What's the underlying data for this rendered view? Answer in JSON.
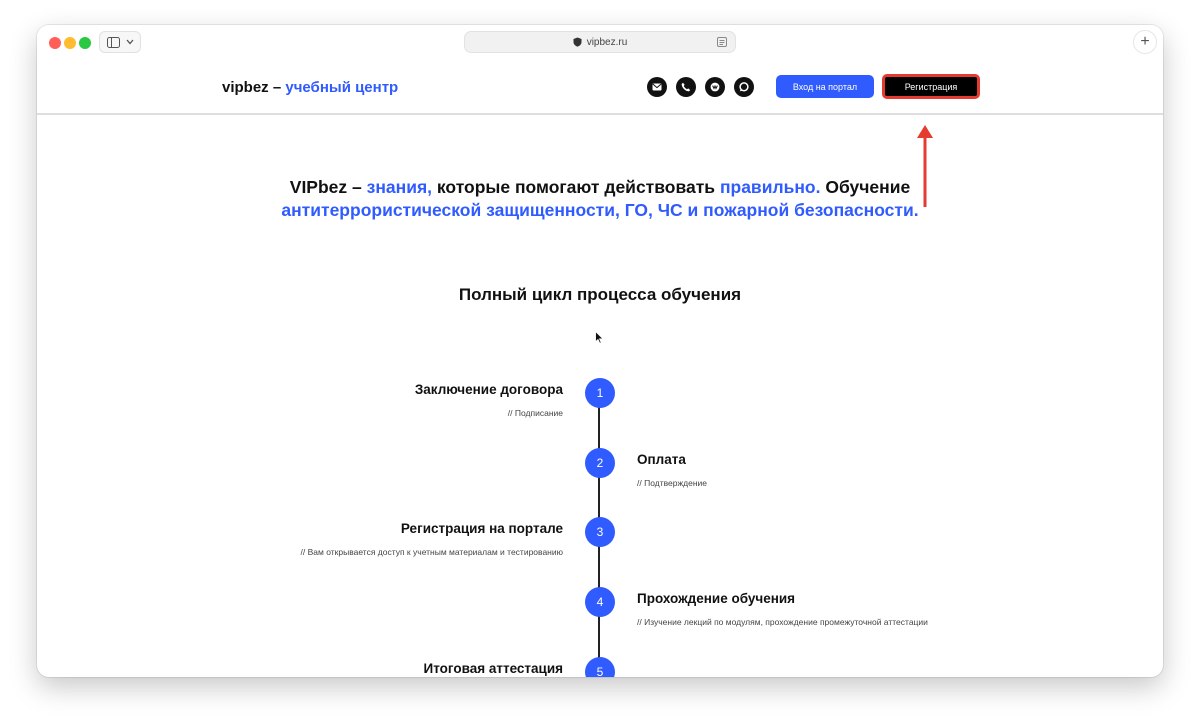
{
  "browser": {
    "url": "vipbez.ru",
    "traffic_lights": [
      "#ff5f57",
      "#febc2e",
      "#28c840"
    ]
  },
  "header": {
    "logo_main": "vipbez –",
    "logo_accent": "учебный центр",
    "social_icons": [
      "mail-icon",
      "phone-icon",
      "vk-icon",
      "chat-icon"
    ],
    "portal_button": "Вход на портал",
    "register_button": "Регистрация"
  },
  "hero": {
    "part1": "VIPbez –",
    "part2": "знания,",
    "part3": "которые помогают действовать",
    "part4": "правильно.",
    "part5": "Обучение",
    "part6": "антитеррористической защищенности, ГО, ЧС и пожарной безопасности."
  },
  "section_title": "Полный цикл процесса обучения",
  "steps": [
    {
      "num": "1",
      "title": "Заключение договора",
      "sub": "// Подписание"
    },
    {
      "num": "2",
      "title": "Оплата",
      "sub": "// Подтверждение"
    },
    {
      "num": "3",
      "title": "Регистрация на портале",
      "sub": "// Вам открывается доступ к учетным материалам и тестированию"
    },
    {
      "num": "4",
      "title": "Прохождение обучения",
      "sub": "// Изучение лекций по модулям, прохождение промежуточной аттестации"
    },
    {
      "num": "5",
      "title": "Итоговая аттестация",
      "sub": ""
    }
  ],
  "colors": {
    "accent": "#2f5bff",
    "annotation": "#e53a2f"
  }
}
